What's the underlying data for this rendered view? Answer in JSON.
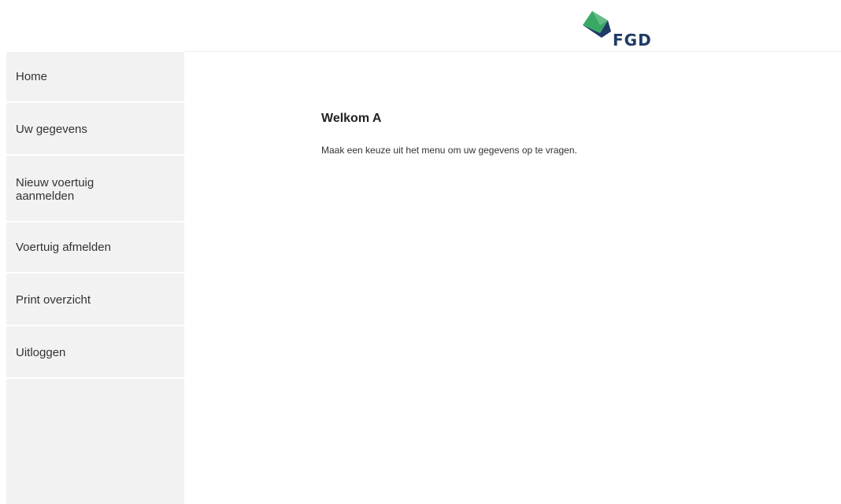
{
  "header": {
    "logo": {
      "text": "FGD",
      "colors": {
        "green": "#3aa865",
        "blue": "#1f3b66",
        "mid": "#2c6aa0"
      }
    }
  },
  "sidebar": {
    "items": [
      {
        "label": "Home"
      },
      {
        "label": "Uw gegevens"
      },
      {
        "label": "Nieuw voertuig aanmelden"
      },
      {
        "label": "Voertuig afmelden"
      },
      {
        "label": "Print overzicht"
      },
      {
        "label": "Uitloggen"
      }
    ]
  },
  "main": {
    "title": "Welkom A",
    "intro": "Maak een keuze uit het menu om uw gegevens op te vragen."
  }
}
